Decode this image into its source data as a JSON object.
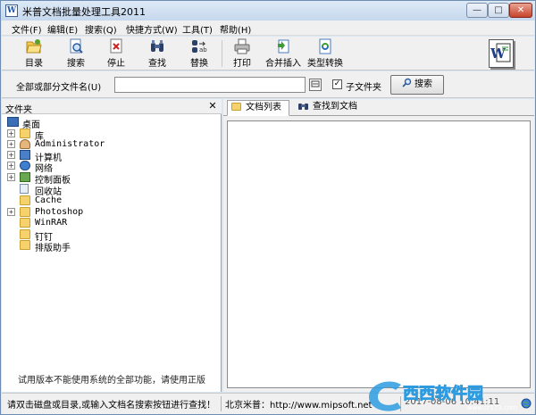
{
  "window": {
    "title": "米普文档批量处理工具2011",
    "logo_letter": "W"
  },
  "window_controls": {
    "minimize": "—",
    "maximize": "□",
    "close": "✕"
  },
  "menu": [
    {
      "label": "文件(F)"
    },
    {
      "label": "编辑(E)"
    },
    {
      "label": "搜索(Q)"
    },
    {
      "label": "快捷方式(W)"
    },
    {
      "label": "工具(T)"
    },
    {
      "label": "帮助(H)"
    }
  ],
  "toolbar": [
    {
      "label": "目录",
      "icon": "folder-open-icon"
    },
    {
      "label": "搜索",
      "icon": "search-doc-icon"
    },
    {
      "label": "停止",
      "icon": "stop-icon"
    },
    {
      "label": "查找",
      "icon": "binoculars-icon"
    },
    {
      "label": "替换",
      "icon": "replace-icon"
    },
    {
      "label": "打印",
      "icon": "printer-icon"
    },
    {
      "label": "合并插入",
      "icon": "merge-insert-icon"
    },
    {
      "label": "类型转换",
      "icon": "type-convert-icon"
    }
  ],
  "search": {
    "label": "全部或部分文件名(U)",
    "value": "",
    "subfolder_label": "子文件夹",
    "subfolder_checked": "✓",
    "button_label": "搜索"
  },
  "folder_panel": {
    "title": "文件夹",
    "close": "✕",
    "tree": [
      {
        "label": "桌面",
        "expander": ""
      },
      {
        "label": "库",
        "expander": "+"
      },
      {
        "label": "Administrator",
        "expander": "+"
      },
      {
        "label": "计算机",
        "expander": "+"
      },
      {
        "label": "网络",
        "expander": "+"
      },
      {
        "label": "控制面板",
        "expander": "+"
      },
      {
        "label": "回收站",
        "expander": ""
      },
      {
        "label": "Cache",
        "expander": ""
      },
      {
        "label": "Photoshop",
        "expander": "+"
      },
      {
        "label": "WinRAR",
        "expander": ""
      },
      {
        "label": "钉钉",
        "expander": ""
      },
      {
        "label": "排版助手",
        "expander": ""
      }
    ],
    "trial_note": "试用版本不能使用系统的全部功能，请使用正版"
  },
  "tabs": [
    {
      "label": "文档列表",
      "active": true
    },
    {
      "label": "查找到文档",
      "active": false
    }
  ],
  "status": {
    "hint": "请双击磁盘或目录,或输入文档名搜索按钮进行查找！",
    "company": "北京米普：http://www.mipsoft.net",
    "datetime": "2017-08-06 10:41:11"
  },
  "watermark": {
    "text": "西西软件园",
    "site": "www.cr173.com"
  },
  "colors": {
    "frame": "#d9e6f4",
    "close_button": "#c7432a",
    "folder": "#f5d26b"
  }
}
